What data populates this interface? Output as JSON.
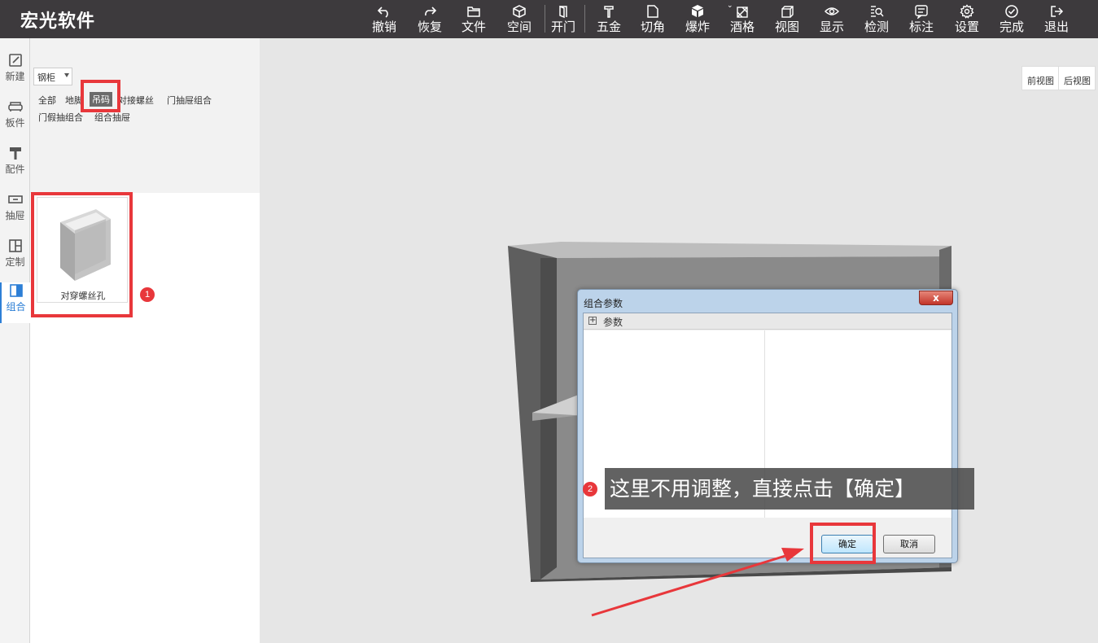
{
  "app": {
    "title": "宏光软件"
  },
  "toolbar": {
    "items": [
      {
        "label": "撤销",
        "icon": "undo-icon"
      },
      {
        "label": "恢复",
        "icon": "redo-icon"
      },
      {
        "label": "文件",
        "icon": "folder-icon"
      },
      {
        "label": "空间",
        "icon": "cube-icon"
      },
      {
        "label": "开门",
        "icon": "door-icon"
      },
      {
        "label": "五金",
        "icon": "hardware-icon"
      },
      {
        "label": "切角",
        "icon": "cut-corner-icon"
      },
      {
        "label": "爆炸",
        "icon": "explode-icon"
      },
      {
        "label": "酒格",
        "icon": "wine-grid-icon"
      },
      {
        "label": "视图",
        "icon": "view-icon"
      },
      {
        "label": "显示",
        "icon": "eye-icon"
      },
      {
        "label": "检测",
        "icon": "detect-icon"
      },
      {
        "label": "标注",
        "icon": "annotate-icon"
      },
      {
        "label": "设置",
        "icon": "gear-icon"
      },
      {
        "label": "完成",
        "icon": "check-icon"
      },
      {
        "label": "退出",
        "icon": "exit-icon"
      }
    ]
  },
  "sidebar": {
    "items": [
      {
        "label": "新建",
        "icon": "edit-icon"
      },
      {
        "label": "板件",
        "icon": "sofa-icon"
      },
      {
        "label": "配件",
        "icon": "hammer-icon"
      },
      {
        "label": "抽屉",
        "icon": "drawer-icon"
      },
      {
        "label": "定制",
        "icon": "custom-icon"
      },
      {
        "label": "组合",
        "icon": "combo-icon"
      }
    ]
  },
  "library": {
    "select_value": "钢柜",
    "categories": [
      "全部",
      "地脚",
      "吊码",
      "对接螺丝",
      "门抽屉组合",
      "门假抽组合",
      "组合抽屉"
    ],
    "active_category": "吊码",
    "items": [
      {
        "label": "对穿螺丝孔"
      }
    ]
  },
  "viewport": {
    "buttons": [
      "前视图",
      "后视图"
    ]
  },
  "dialog": {
    "title": "组合参数",
    "close_label": "x",
    "group_label": "参数",
    "ok_label": "确定",
    "cancel_label": "取消"
  },
  "annotations": {
    "badge1": "1",
    "badge2": "2",
    "callout": "这里不用调整，直接点击【确定】"
  },
  "colors": {
    "topbar": "#3d3a3d",
    "highlight": "#e8373b",
    "active_nav": "#2d7fd6"
  }
}
